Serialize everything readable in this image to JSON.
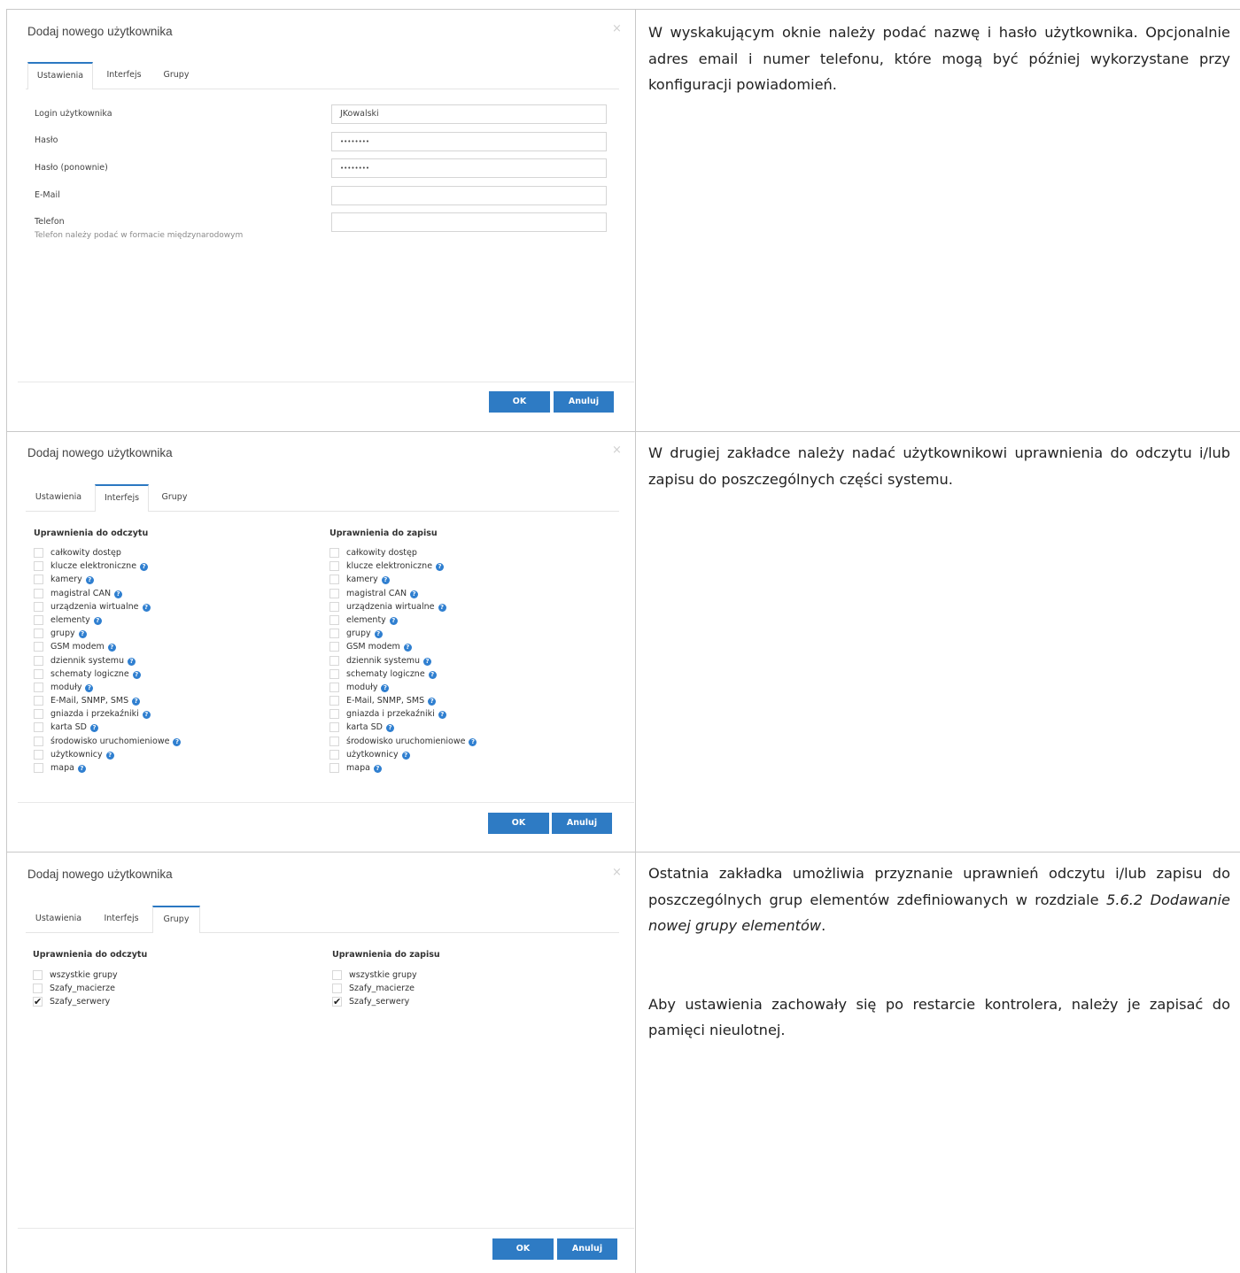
{
  "panel1": {
    "title": "Dodaj nowego użytkownika",
    "close": "×",
    "tabs": [
      "Ustawienia",
      "Interfejs",
      "Grupy"
    ],
    "fields": [
      {
        "label": "Login użytkownika",
        "value": "JKowalski"
      },
      {
        "label": "Hasło",
        "value": "••••••••"
      },
      {
        "label": "Hasło (ponownie)",
        "value": "••••••••"
      },
      {
        "label": "E-Mail",
        "value": ""
      },
      {
        "label": "Telefon",
        "value": ""
      }
    ],
    "phone_hint": "Telefon należy podać w formacie międzynarodowym",
    "ok": "OK",
    "cancel": "Anuluj"
  },
  "panel2": {
    "title": "Dodaj nowego użytkownika",
    "close": "×",
    "tabs": [
      "Ustawienia",
      "Interfejs",
      "Grupy"
    ],
    "read_heading": "Uprawnienia do odczytu",
    "write_heading": "Uprawnienia do zapisu",
    "items": [
      {
        "label": "całkowity dostęp",
        "help": false
      },
      {
        "label": "klucze elektroniczne",
        "help": true
      },
      {
        "label": "kamery",
        "help": true
      },
      {
        "label": "magistral CAN",
        "help": true
      },
      {
        "label": "urządzenia wirtualne",
        "help": true
      },
      {
        "label": "elementy",
        "help": true
      },
      {
        "label": "grupy",
        "help": true
      },
      {
        "label": "GSM modem",
        "help": true
      },
      {
        "label": "dziennik systemu",
        "help": true
      },
      {
        "label": "schematy logiczne",
        "help": true
      },
      {
        "label": "moduły",
        "help": true
      },
      {
        "label": "E-Mail, SNMP, SMS",
        "help": true
      },
      {
        "label": "gniazda i przekaźniki",
        "help": true
      },
      {
        "label": "karta SD",
        "help": true
      },
      {
        "label": "środowisko uruchomieniowe",
        "help": true
      },
      {
        "label": "użytkownicy",
        "help": true
      },
      {
        "label": "mapa",
        "help": true
      }
    ],
    "help_glyph": "?",
    "ok": "OK",
    "cancel": "Anuluj"
  },
  "panel3": {
    "title": "Dodaj nowego użytkownika",
    "close": "×",
    "tabs": [
      "Ustawienia",
      "Interfejs",
      "Grupy"
    ],
    "read_heading": "Uprawnienia do odczytu",
    "write_heading": "Uprawnienia do zapisu",
    "groups": [
      {
        "label": "wszystkie grupy",
        "checked": false
      },
      {
        "label": "Szafy_macierze",
        "checked": false
      },
      {
        "label": "Szafy_serwery",
        "checked": true
      }
    ],
    "ok": "OK",
    "cancel": "Anuluj"
  },
  "descriptions": {
    "d1": "W wyskakującym oknie należy podać nazwę i hasło użytkownika. Opcjonalnie adres email i numer telefonu, które mogą być później wykorzystane przy konfiguracji powiadomień.",
    "d2": "W drugiej zakładce należy nadać użytkownikowi uprawnienia do odczytu i/lub zapisu do poszczególnych części systemu.",
    "d3_prefix": "Ostatnia zakładka umożliwia przyznanie uprawnień odczytu i/lub zapisu do poszczególnych grup elementów zdefiniowanych w rozdziale ",
    "d3_ref": "5.6.2 Dodawanie nowej grupy elementów",
    "d3_suffix": ".",
    "d4": "Aby ustawienia zachowały się po restarcie kontrolera, należy je zapisać do pamięci nieulotnej."
  }
}
